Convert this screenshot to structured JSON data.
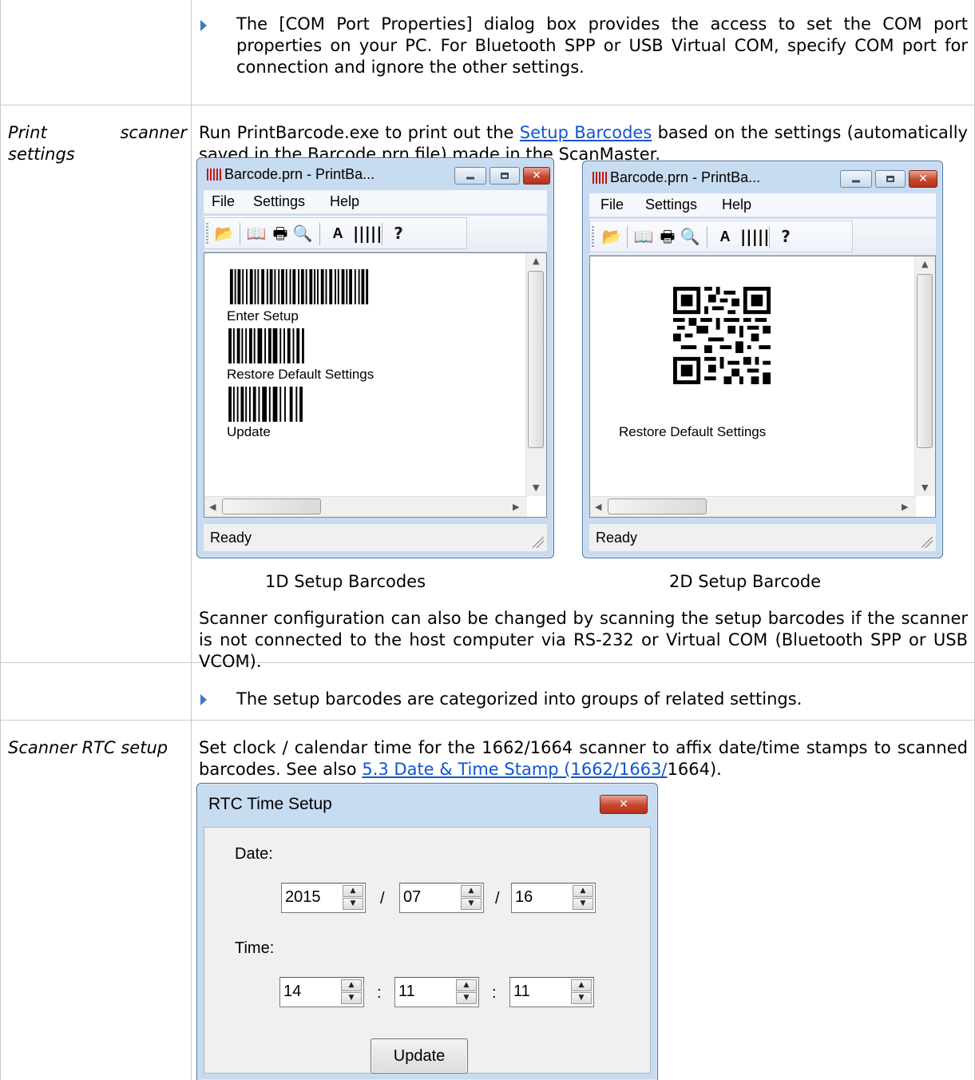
{
  "rows": {
    "top": {
      "note": "The [COM Port Properties] dialog box provides the access to set the COM port properties on your PC. For Bluetooth SPP or USB Virtual COM, specify COM port for connection and ignore the other settings."
    },
    "print": {
      "label": "Print scanner settings",
      "intro_before": "Run PrintBarcode.exe to print out the ",
      "intro_link": "Setup Barcodes",
      "intro_after": " based on the settings (automatically saved in the Barcode.prn file) made in the ScanMaster.",
      "caption_1d": "1D Setup Barcodes",
      "caption_2d": "2D Setup Barcode",
      "para": "Scanner configuration can also be changed by scanning the setup barcodes if the scanner is not connected to the host computer via RS-232 or Virtual COM (Bluetooth SPP or USB VCOM).",
      "note": "The setup barcodes are categorized into groups of related settings."
    },
    "rtc": {
      "label": "Scanner RTC setup",
      "intro_before": "Set clock / calendar time for the 1662/1664 scanner to affix date/time stamps to scanned barcodes. See also ",
      "intro_link": "5.3 Date & Time Stamp (1662/1663/",
      "intro_after": "1664)."
    }
  },
  "printbarcode_window": {
    "title": "Barcode.prn - PrintBa...",
    "menu": [
      "File",
      "Settings",
      "Help"
    ],
    "status": "Ready",
    "toolbar_icons": [
      "open-icon",
      "book-icon",
      "print-icon",
      "print-preview-icon",
      "font-icon",
      "barcode-icon",
      "help-icon"
    ]
  },
  "window_1d": {
    "barcodes": [
      "Enter Setup",
      "Restore Default Settings",
      "Update"
    ]
  },
  "window_2d": {
    "barcode_label": "Restore Default Settings"
  },
  "rtc_dialog": {
    "title": "RTC Time Setup",
    "date_label": "Date:",
    "time_label": "Time:",
    "date_sep": "/",
    "time_sep": ":",
    "year": "2015",
    "month": "07",
    "day": "16",
    "hour": "14",
    "minute": "11",
    "second": "11",
    "update_button": "Update"
  }
}
